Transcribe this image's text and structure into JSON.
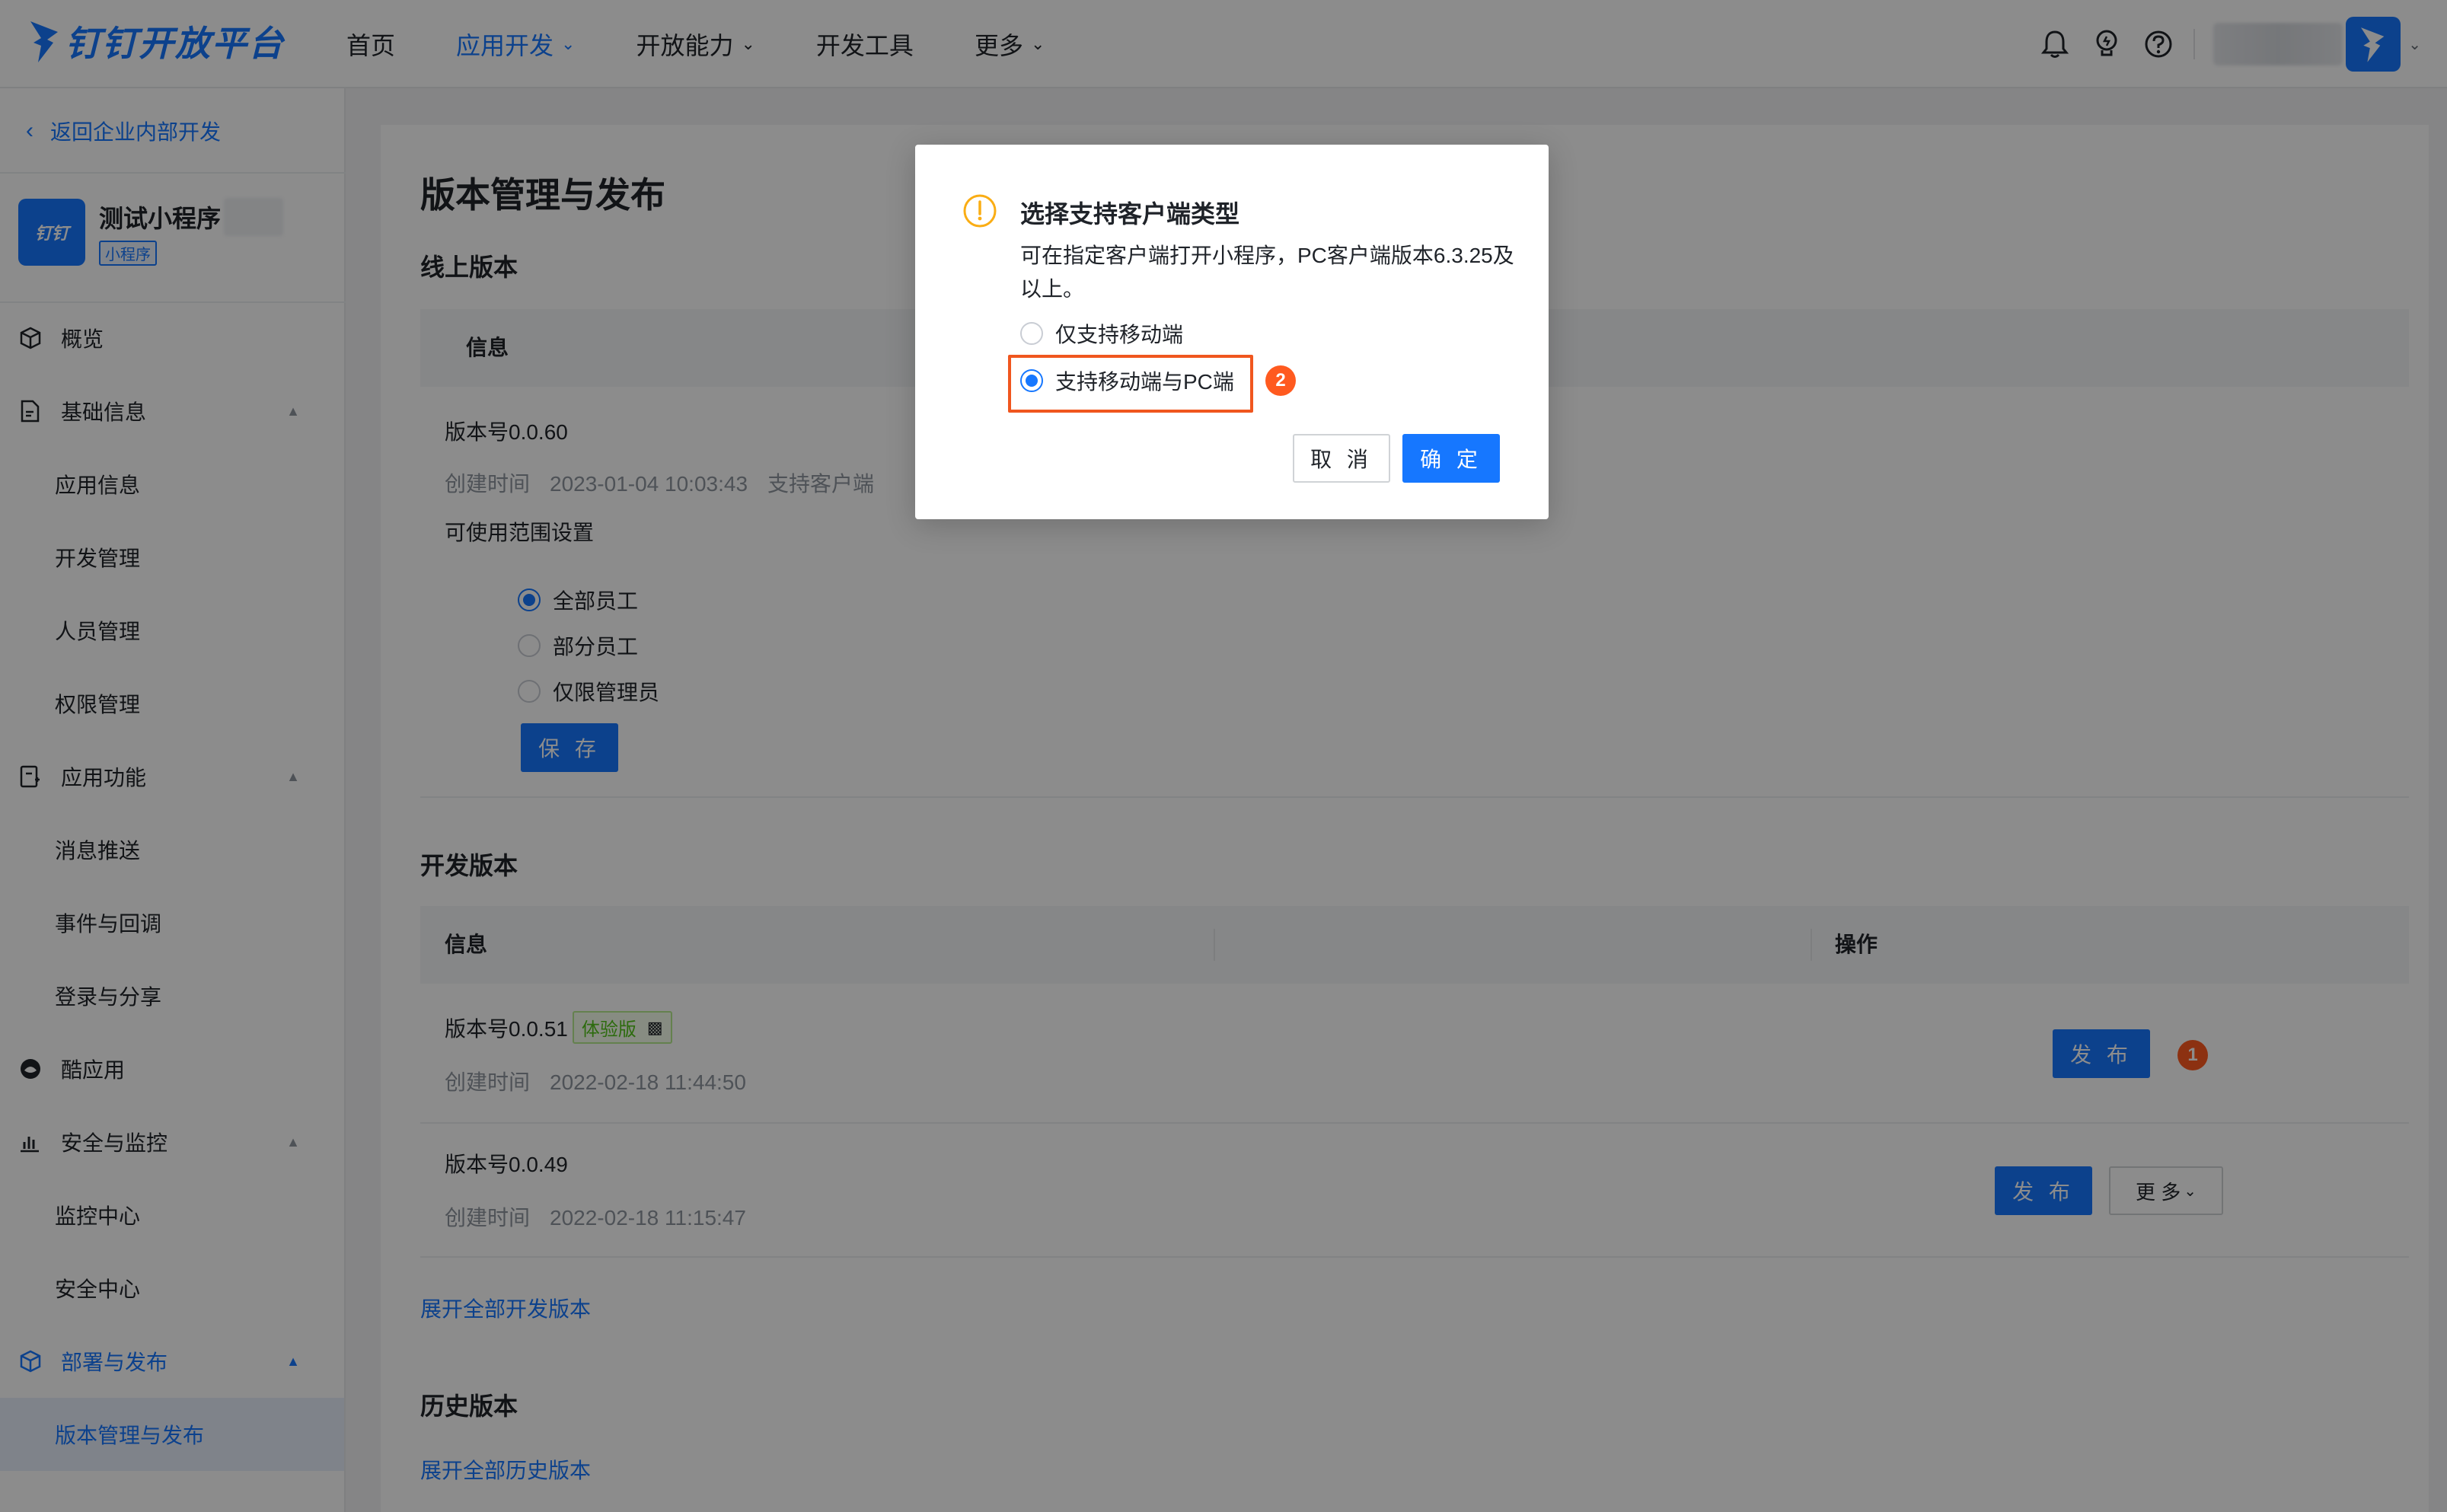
{
  "header": {
    "logo_text": "钉钉开放平台",
    "nav": [
      {
        "label": "首页"
      },
      {
        "label": "应用开发"
      },
      {
        "label": "开放能力"
      },
      {
        "label": "开发工具"
      },
      {
        "label": "更多"
      }
    ],
    "icons": [
      "bell-icon",
      "bulb-icon",
      "help-icon"
    ],
    "accent_color": "#1677ff"
  },
  "sidebar": {
    "back_label": "返回企业内部开发",
    "app_name": "测试小程序",
    "app_tag": "小程序",
    "app_icon_text": "钉钉",
    "groups": [
      {
        "label": "概览"
      },
      {
        "label": "基础信息",
        "subs": [
          "应用信息",
          "开发管理",
          "人员管理",
          "权限管理"
        ]
      },
      {
        "label": "应用功能",
        "subs": [
          "消息推送",
          "事件与回调",
          "登录与分享"
        ]
      },
      {
        "label": "酷应用"
      },
      {
        "label": "安全与监控",
        "subs": [
          "监控中心",
          "安全中心"
        ]
      },
      {
        "label": "部署与发布",
        "subs": [
          "版本管理与发布"
        ]
      }
    ]
  },
  "main": {
    "page_title": "版本管理与发布",
    "online": {
      "section_title": "线上版本",
      "col_info": "信息",
      "version": "版本号0.0.60",
      "created_label": "创建时间",
      "created_time": "2023-01-04 10:03:43",
      "support_partial": "支持客户端",
      "scope_label": "可使用范围设置",
      "scope_options": [
        "全部员工",
        "部分员工",
        "仅限管理员"
      ],
      "save_label": "保 存"
    },
    "dev": {
      "section_title": "开发版本",
      "col_info": "信息",
      "col_action": "操作",
      "rows": [
        {
          "version": "版本号0.0.51",
          "tag": "体验版",
          "created_label": "创建时间",
          "created_time": "2022-02-18 11:44:50",
          "publish": "发 布",
          "badge": "1"
        },
        {
          "version": "版本号0.0.49",
          "created_label": "创建时间",
          "created_time": "2022-02-18 11:15:47",
          "publish": "发 布",
          "more": "更 多"
        }
      ],
      "expand_link": "展开全部开发版本"
    },
    "history": {
      "section_title": "历史版本",
      "expand_link": "展开全部历史版本"
    }
  },
  "modal": {
    "title": "选择支持客户端类型",
    "desc": "可在指定客户端打开小程序，PC客户端版本6.3.25及以上。",
    "options": [
      "仅支持移动端",
      "支持移动端与PC端"
    ],
    "selected_index": 1,
    "badge": "2",
    "cancel_label": "取 消",
    "ok_label": "确 定",
    "warning_color": "#faad14"
  }
}
